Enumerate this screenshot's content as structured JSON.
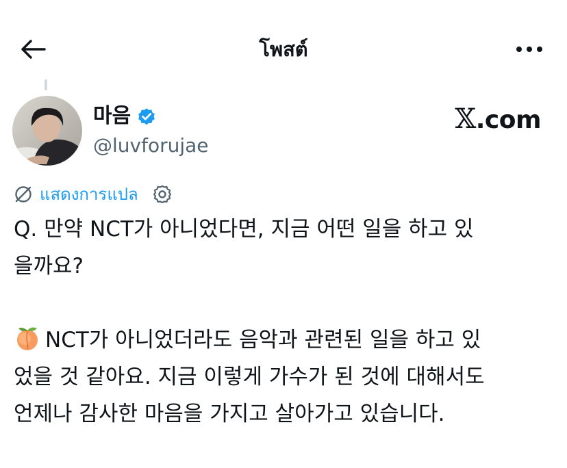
{
  "header": {
    "title": "โพสต์",
    "back_icon": "arrow-left-icon",
    "more_icon": "more-horizontal-icon"
  },
  "author": {
    "display_name": "마음",
    "handle": "@luvforujae",
    "verified_color": "#1d9bf0"
  },
  "watermark": {
    "x": "𝕏",
    "rest": ".com"
  },
  "translate": {
    "label": "แสดงการแปล",
    "color": "#1d9bf0"
  },
  "tweet": {
    "question_line1": "Q. 만약 NCT가 아니었다면, 지금 어떤 일을 하고 있",
    "question_line2": "을까요?",
    "answer_emoji_icon": "peach-emoji-icon",
    "answer_line1": "NCT가 아니었더라도 음악과 관련된 일을 하고 있",
    "answer_line2": "었을 것 같아요. 지금 이렇게 가수가 된 것에 대해서도",
    "answer_line3": "언제나 감사한 마음을 가지고 살아가고 있습니다."
  },
  "colors": {
    "text": "#0f1419",
    "secondary": "#536471",
    "accent": "#1d9bf0"
  }
}
